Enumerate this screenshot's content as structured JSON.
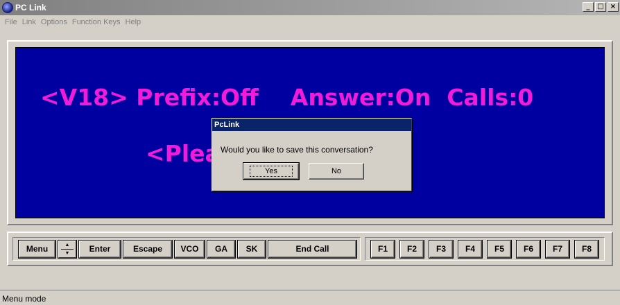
{
  "window": {
    "title": "PC Link"
  },
  "window_controls": {
    "minimize": "_",
    "maximize": "□",
    "close": "×"
  },
  "menu": [
    "File",
    "Link",
    "Options",
    "Function Keys",
    "Help"
  ],
  "screen": {
    "line1": "<V18> Prefix:Off    Answer:On  Calls:0",
    "line2": "<Plea"
  },
  "dialog": {
    "title": "PcLink",
    "message": "Would you like to save this conversation?",
    "yes": "Yes",
    "no": "No"
  },
  "buttons": {
    "menu": "Menu",
    "spin_up": "▲",
    "spin_down": "▼",
    "enter": "Enter",
    "escape": "Escape",
    "vco": "VCO",
    "ga": "GA",
    "sk": "SK",
    "end_call": "End Call"
  },
  "function_keys": [
    "F1",
    "F2",
    "F3",
    "F4",
    "F5",
    "F6",
    "F7",
    "F8"
  ],
  "status": "Menu mode",
  "colors": {
    "screen_bg": "#0000a0",
    "screen_text": "#f21bd9",
    "dialog_title_bg": "#0a246a"
  }
}
